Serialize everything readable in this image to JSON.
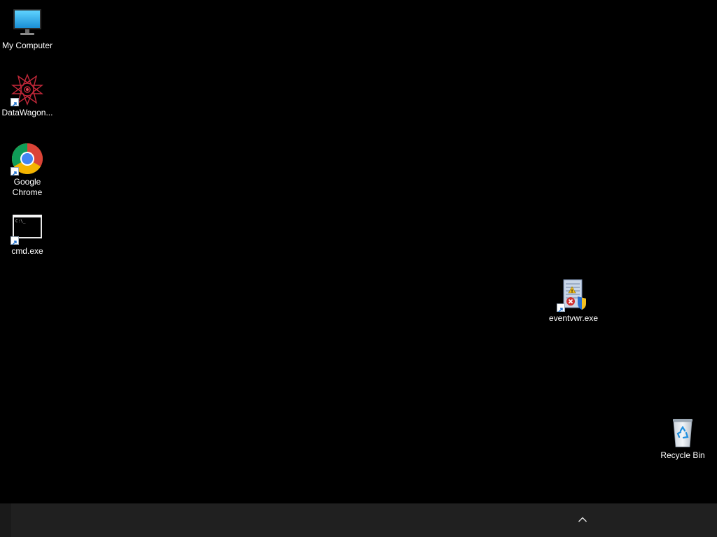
{
  "desktop": {
    "icons": [
      {
        "label": "My Computer",
        "icon": "monitor-icon",
        "shortcut": false
      },
      {
        "label": "DataWagon...",
        "icon": "datawagon-icon",
        "shortcut": true
      },
      {
        "label": "Google\nChrome",
        "icon": "chrome-icon",
        "shortcut": true
      },
      {
        "label": "cmd.exe",
        "icon": "cmd-icon",
        "shortcut": true
      },
      {
        "label": "eventvwr.exe",
        "icon": "event-viewer-icon",
        "shortcut": true
      },
      {
        "label": "Recycle Bin",
        "icon": "recycle-bin-icon",
        "shortcut": false
      }
    ]
  },
  "taskbar": {
    "tray_chevron_icon": "chevron-up-icon",
    "background": "#202020"
  },
  "colors": {
    "desktop_background": "#000000",
    "chrome_red": "#db4437",
    "chrome_yellow": "#f4b400",
    "chrome_green": "#0f9d58",
    "chrome_blue": "#4285f4"
  }
}
